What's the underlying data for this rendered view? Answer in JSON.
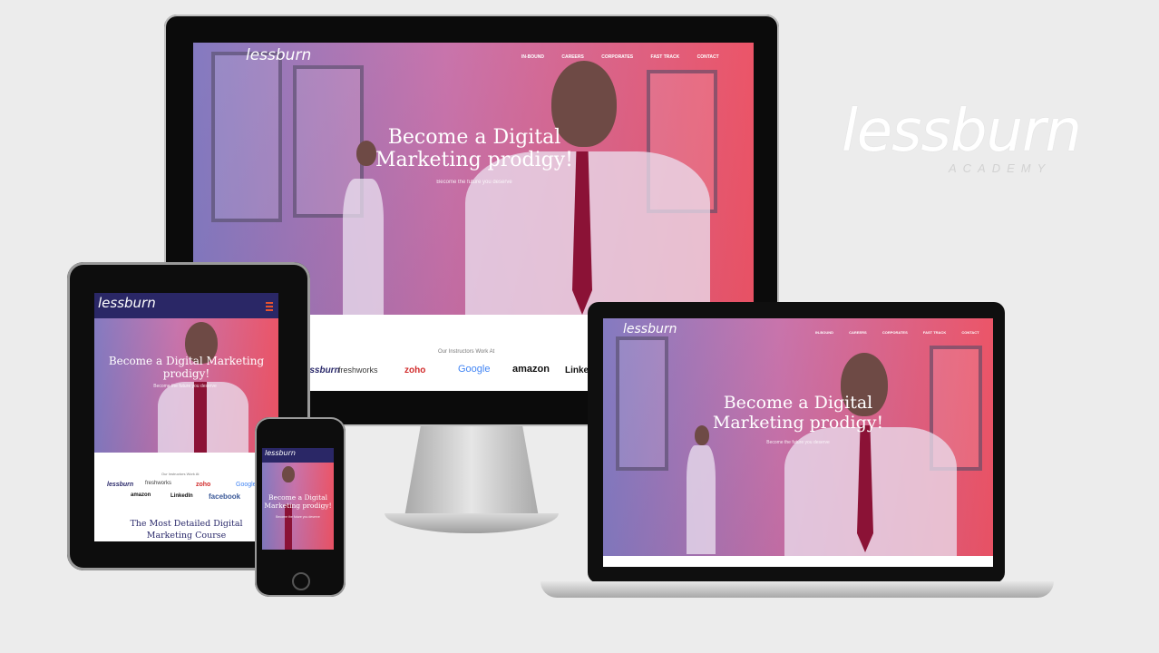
{
  "brand": {
    "logo_word": "lessburn",
    "logo_sub": "ACADEMY",
    "accent": "#e8532e"
  },
  "desktop": {
    "nav": [
      "IN-BOUND",
      "CAREERS",
      "CORPORATES",
      "FAST TRACK",
      "CONTACT"
    ],
    "hero_title_line1": "Become a Digital",
    "hero_title_line2": "Marketing prodigy!",
    "hero_sub": "Become the future you deserve",
    "partners_heading": "Our Instructors Work At",
    "partners": [
      "lessburn",
      "freshworks",
      "zoho",
      "Google",
      "amazon",
      "LinkedIn"
    ]
  },
  "laptop": {
    "nav": [
      "IN-BOUND",
      "CAREERS",
      "CORPORATES",
      "FAST TRACK",
      "CONTACT"
    ],
    "hero_title_line1": "Become a Digital",
    "hero_title_line2": "Marketing prodigy!",
    "hero_sub": "Become the future you deserve"
  },
  "tablet": {
    "hero_title_line1": "Become a Digital Marketing",
    "hero_title_line2": "prodigy!",
    "hero_sub": "Become the future you deserve",
    "partners_heading": "Our Instructors Work At",
    "partners_row1": [
      "lessburn",
      "freshworks",
      "zoho",
      "Google"
    ],
    "partners_row2": [
      "amazon",
      "LinkedIn",
      "facebook"
    ],
    "course_line1": "The Most Detailed Digital",
    "course_line2": "Marketing Course"
  },
  "phone": {
    "hero_title_line1": "Become a Digital",
    "hero_title_line2": "Marketing prodigy!",
    "hero_sub": "Become the future you deserve"
  }
}
